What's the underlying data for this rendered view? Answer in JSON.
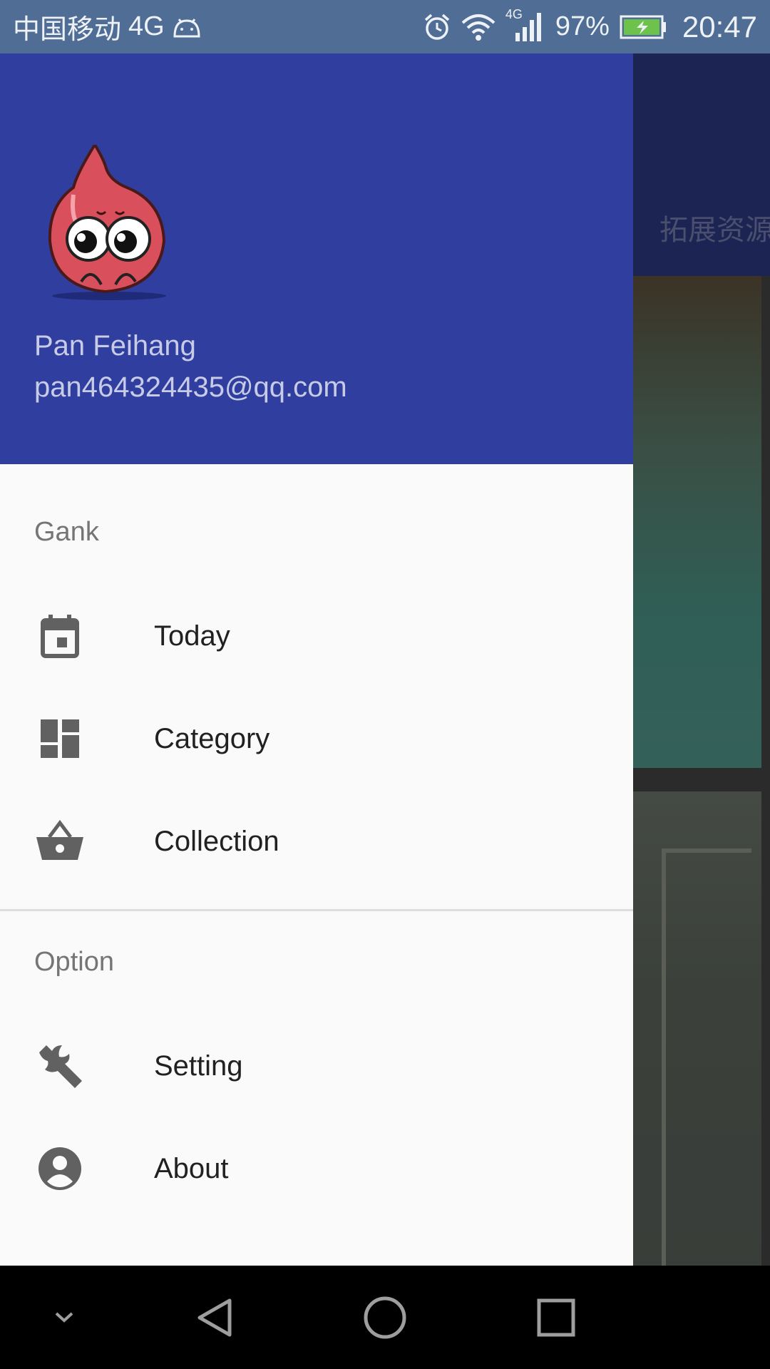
{
  "status_bar": {
    "carrier": "中国移动",
    "network": "4G",
    "signal_type": "4G",
    "battery": "97%",
    "time": "20:47",
    "icons": [
      "android-icon",
      "alarm-icon",
      "wifi-icon",
      "signal-icon",
      "battery-icon"
    ]
  },
  "background_app": {
    "tab_label": "拓展资源"
  },
  "drawer": {
    "header": {
      "name": "Pan Feihang",
      "email": "pan464324435@qq.com",
      "header_color": "#303f9f"
    },
    "sections": [
      {
        "title": "Gank",
        "items": [
          {
            "label": "Today",
            "icon": "calendar-icon"
          },
          {
            "label": "Category",
            "icon": "dashboard-icon"
          },
          {
            "label": "Collection",
            "icon": "basket-icon"
          }
        ]
      },
      {
        "title": "Option",
        "items": [
          {
            "label": "Setting",
            "icon": "wrench-icon"
          },
          {
            "label": "About",
            "icon": "account-circle-icon"
          }
        ]
      }
    ]
  },
  "nav_bar": {
    "buttons": [
      "hide-keyboard-icon",
      "back-icon",
      "home-icon",
      "recents-icon"
    ]
  }
}
